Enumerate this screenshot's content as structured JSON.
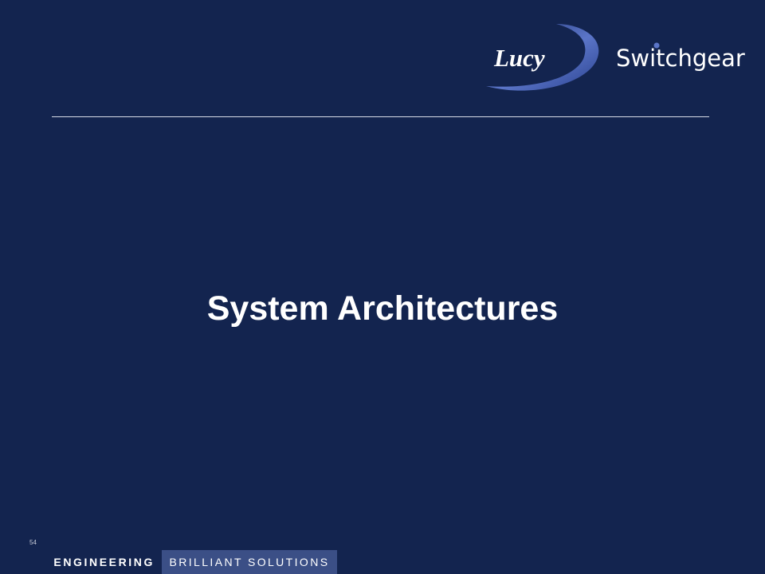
{
  "slide": {
    "title": "System Architectures",
    "page_number": "54"
  },
  "logo": {
    "word_left": "Lucy",
    "word_right": "Switchgear",
    "icon": "lucy-switchgear-logo-icon"
  },
  "footer": {
    "left_text": "ENGINEERING",
    "right_text": "BRILLIANT SOLUTIONS"
  },
  "colors": {
    "background": "#13244f",
    "footer_highlight": "#3b4f86",
    "text": "#ffffff"
  }
}
